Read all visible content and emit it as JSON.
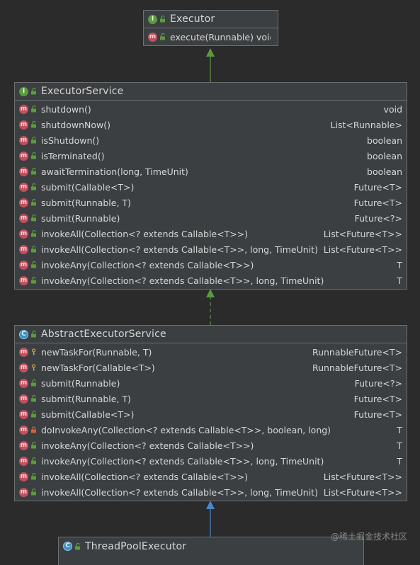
{
  "colors": {
    "background": "#2b2b2b",
    "box_fill": "#3c3f41",
    "border": "#6b6f72",
    "extends_arrow": "#5b9b3e",
    "implements_arrow": "#5b9b3e",
    "class_extends_arrow": "#4a86c8",
    "method_badge": "#c0505d",
    "interface_badge": "#5b9b3e",
    "class_badge": "#3d8fbf"
  },
  "executor": {
    "badge": "I",
    "name": "Executor",
    "methods": [
      {
        "badge": "m",
        "visibility": "public",
        "name": "execute(Runnable) void",
        "type": ""
      }
    ]
  },
  "executor_service": {
    "badge": "I",
    "name": "ExecutorService",
    "methods": [
      {
        "badge": "m",
        "visibility": "public",
        "name": "shutdown()",
        "type": "void"
      },
      {
        "badge": "m",
        "visibility": "public",
        "name": "shutdownNow()",
        "type": "List<Runnable>"
      },
      {
        "badge": "m",
        "visibility": "public",
        "name": "isShutdown()",
        "type": "boolean"
      },
      {
        "badge": "m",
        "visibility": "public",
        "name": "isTerminated()",
        "type": "boolean"
      },
      {
        "badge": "m",
        "visibility": "public",
        "name": "awaitTermination(long, TimeUnit)",
        "type": "boolean"
      },
      {
        "badge": "m",
        "visibility": "public",
        "name": "submit(Callable<T>)",
        "type": "Future<T>"
      },
      {
        "badge": "m",
        "visibility": "public",
        "name": "submit(Runnable, T)",
        "type": "Future<T>"
      },
      {
        "badge": "m",
        "visibility": "public",
        "name": "submit(Runnable)",
        "type": "Future<?>"
      },
      {
        "badge": "m",
        "visibility": "public",
        "name": "invokeAll(Collection<? extends Callable<T>>)",
        "type": "List<Future<T>>"
      },
      {
        "badge": "m",
        "visibility": "public",
        "name": "invokeAll(Collection<? extends Callable<T>>, long, TimeUnit)",
        "type": "List<Future<T>>"
      },
      {
        "badge": "m",
        "visibility": "public",
        "name": "invokeAny(Collection<? extends Callable<T>>)",
        "type": "T"
      },
      {
        "badge": "m",
        "visibility": "public",
        "name": "invokeAny(Collection<? extends Callable<T>>, long, TimeUnit)",
        "type": "T"
      }
    ]
  },
  "abstract_executor_service": {
    "badge": "C",
    "name": "AbstractExecutorService",
    "methods": [
      {
        "badge": "m",
        "visibility": "protected",
        "name": "newTaskFor(Runnable, T)",
        "type": "RunnableFuture<T>"
      },
      {
        "badge": "m",
        "visibility": "protected",
        "name": "newTaskFor(Callable<T>)",
        "type": "RunnableFuture<T>"
      },
      {
        "badge": "m",
        "visibility": "public",
        "name": "submit(Runnable)",
        "type": "Future<?>"
      },
      {
        "badge": "m",
        "visibility": "public",
        "name": "submit(Runnable, T)",
        "type": "Future<T>"
      },
      {
        "badge": "m",
        "visibility": "public",
        "name": "submit(Callable<T>)",
        "type": "Future<T>"
      },
      {
        "badge": "m",
        "visibility": "private",
        "name": "doInvokeAny(Collection<? extends Callable<T>>, boolean, long)",
        "type": "T"
      },
      {
        "badge": "m",
        "visibility": "public",
        "name": "invokeAny(Collection<? extends Callable<T>>)",
        "type": "T"
      },
      {
        "badge": "m",
        "visibility": "public",
        "name": "invokeAny(Collection<? extends Callable<T>>, long, TimeUnit)",
        "type": "T"
      },
      {
        "badge": "m",
        "visibility": "public",
        "name": "invokeAll(Collection<? extends Callable<T>>)",
        "type": "List<Future<T>>"
      },
      {
        "badge": "m",
        "visibility": "public",
        "name": "invokeAll(Collection<? extends Callable<T>>, long, TimeUnit)",
        "type": "List<Future<T>>"
      }
    ]
  },
  "thread_pool_executor": {
    "badge": "C",
    "name": "ThreadPoolExecutor"
  },
  "watermark": "@稀土掘金技术社区"
}
